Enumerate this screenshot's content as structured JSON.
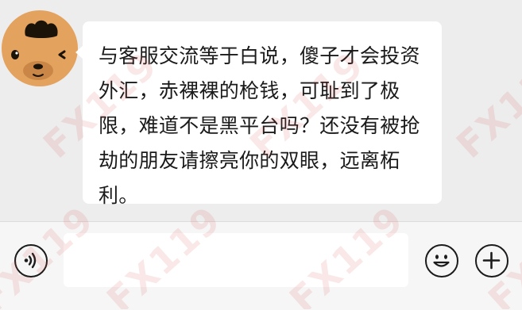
{
  "chat": {
    "message": "与客服交流等于白说，傻子才会投资外汇，赤裸裸的枪钱，可耻到了极限，难道不是黑平台吗？还没有被抢劫的朋友请擦亮你的双眼，远离柘利。",
    "avatar_icon": "bear-face-icon"
  },
  "input_bar": {
    "input_value": "",
    "voice_icon": "voice-icon",
    "emoji_icon": "emoji-icon",
    "plus_icon": "plus-icon"
  },
  "watermark": {
    "text": "FX119"
  },
  "colors": {
    "avatar_bg": "#e3a25e",
    "bubble_bg": "#ffffff",
    "chat_bg": "#ededed",
    "input_bar_bg": "#f6f6f6",
    "watermark": "#d65050"
  }
}
